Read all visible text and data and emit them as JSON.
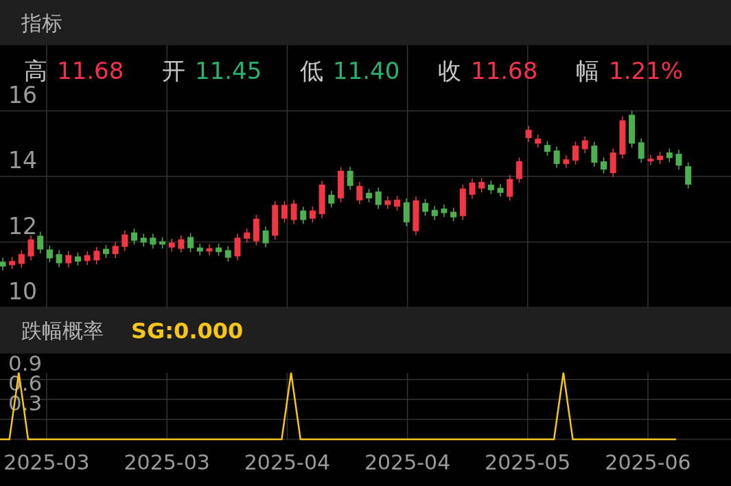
{
  "header": {
    "title": "指标"
  },
  "quote": [
    {
      "label": "高",
      "value": "11.68",
      "color": "#f5314c"
    },
    {
      "label": "开",
      "value": "11.45",
      "color": "#27b36e"
    },
    {
      "label": "低",
      "value": "11.40",
      "color": "#27b36e"
    },
    {
      "label": "收",
      "value": "11.68",
      "color": "#f5314c"
    },
    {
      "label": "幅",
      "value": "1.21%",
      "color": "#f5314c"
    }
  ],
  "price_chart": {
    "chart_data": {
      "type": "candlestick",
      "ylim": [
        10,
        18
      ],
      "yticks": [
        10,
        12,
        14,
        16
      ],
      "grid": true,
      "ohlc": [
        [
          11.4,
          11.52,
          11.13,
          11.25
        ],
        [
          11.29,
          11.54,
          11.17,
          11.42
        ],
        [
          11.33,
          11.75,
          11.21,
          11.63
        ],
        [
          11.56,
          12.2,
          11.44,
          12.08
        ],
        [
          12.19,
          12.31,
          11.65,
          11.77
        ],
        [
          11.77,
          11.89,
          11.38,
          11.5
        ],
        [
          11.63,
          11.75,
          11.23,
          11.35
        ],
        [
          11.35,
          11.72,
          11.23,
          11.6
        ],
        [
          11.56,
          11.68,
          11.28,
          11.4
        ],
        [
          11.42,
          11.72,
          11.3,
          11.6
        ],
        [
          11.44,
          11.85,
          11.32,
          11.73
        ],
        [
          11.79,
          11.91,
          11.51,
          11.63
        ],
        [
          11.63,
          12.0,
          11.51,
          11.88
        ],
        [
          11.85,
          12.35,
          11.73,
          12.23
        ],
        [
          12.29,
          12.41,
          11.92,
          12.04
        ],
        [
          12.13,
          12.25,
          11.86,
          11.98
        ],
        [
          12.13,
          12.25,
          11.8,
          11.92
        ],
        [
          12.02,
          12.14,
          11.8,
          11.92
        ],
        [
          11.83,
          12.1,
          11.71,
          11.98
        ],
        [
          11.79,
          12.2,
          11.67,
          12.08
        ],
        [
          12.15,
          12.27,
          11.69,
          11.81
        ],
        [
          11.83,
          11.95,
          11.59,
          11.71
        ],
        [
          11.71,
          11.93,
          11.59,
          11.81
        ],
        [
          11.83,
          11.95,
          11.57,
          11.69
        ],
        [
          11.75,
          11.87,
          11.4,
          11.52
        ],
        [
          11.56,
          12.25,
          11.44,
          12.13
        ],
        [
          12.1,
          12.41,
          11.98,
          12.29
        ],
        [
          12.02,
          12.83,
          11.9,
          12.71
        ],
        [
          12.35,
          12.47,
          11.84,
          11.96
        ],
        [
          12.19,
          13.25,
          12.07,
          13.13
        ],
        [
          12.71,
          13.25,
          12.59,
          13.13
        ],
        [
          12.67,
          13.29,
          12.55,
          13.17
        ],
        [
          12.96,
          13.08,
          12.55,
          12.67
        ],
        [
          12.71,
          13.08,
          12.59,
          12.96
        ],
        [
          12.85,
          13.87,
          12.73,
          13.75
        ],
        [
          13.44,
          13.56,
          13.05,
          13.17
        ],
        [
          13.33,
          14.29,
          13.21,
          14.17
        ],
        [
          14.17,
          14.29,
          13.59,
          13.71
        ],
        [
          13.27,
          13.83,
          13.15,
          13.71
        ],
        [
          13.5,
          13.62,
          13.21,
          13.33
        ],
        [
          13.54,
          13.66,
          13.01,
          13.13
        ],
        [
          13.13,
          13.39,
          13.01,
          13.27
        ],
        [
          13.08,
          13.41,
          12.96,
          13.29
        ],
        [
          13.21,
          13.33,
          12.48,
          12.6
        ],
        [
          12.33,
          13.39,
          12.21,
          13.27
        ],
        [
          13.19,
          13.31,
          12.8,
          12.92
        ],
        [
          12.98,
          13.1,
          12.67,
          12.79
        ],
        [
          13.02,
          13.14,
          12.76,
          12.88
        ],
        [
          12.92,
          13.04,
          12.63,
          12.75
        ],
        [
          12.79,
          13.75,
          12.67,
          13.63
        ],
        [
          13.44,
          13.93,
          13.32,
          13.81
        ],
        [
          13.63,
          13.95,
          13.51,
          13.83
        ],
        [
          13.75,
          13.87,
          13.46,
          13.58
        ],
        [
          13.65,
          13.77,
          13.38,
          13.5
        ],
        [
          13.38,
          14.04,
          13.26,
          13.92
        ],
        [
          13.92,
          14.58,
          13.8,
          14.46
        ],
        [
          15.17,
          15.54,
          15.05,
          15.42
        ],
        [
          15.0,
          15.27,
          14.88,
          15.15
        ],
        [
          14.96,
          15.08,
          14.63,
          14.75
        ],
        [
          14.79,
          14.91,
          14.26,
          14.38
        ],
        [
          14.38,
          14.64,
          14.26,
          14.52
        ],
        [
          14.48,
          15.06,
          14.36,
          14.94
        ],
        [
          14.83,
          15.22,
          14.71,
          15.1
        ],
        [
          14.94,
          15.06,
          14.3,
          14.42
        ],
        [
          14.46,
          14.58,
          14.09,
          14.21
        ],
        [
          14.1,
          14.85,
          13.98,
          14.73
        ],
        [
          14.67,
          15.83,
          14.55,
          15.71
        ],
        [
          15.88,
          16.0,
          14.88,
          15.0
        ],
        [
          15.04,
          15.16,
          14.42,
          14.54
        ],
        [
          14.46,
          14.66,
          14.34,
          14.54
        ],
        [
          14.5,
          14.75,
          14.38,
          14.63
        ],
        [
          14.73,
          14.85,
          14.44,
          14.56
        ],
        [
          14.69,
          14.81,
          14.21,
          14.33
        ],
        [
          14.31,
          14.43,
          13.63,
          13.75
        ]
      ]
    }
  },
  "indicator": {
    "title": "跌幅概率",
    "reading": "SG:0.000",
    "chart_data": {
      "type": "line",
      "ylim": [
        0,
        1
      ],
      "yticks": [
        0.3,
        0.6,
        0.9
      ],
      "grid": true,
      "series": [
        {
          "color": "#f5c518",
          "values": [
            0,
            0,
            1,
            0,
            0,
            0,
            0,
            0,
            0,
            0,
            0,
            0,
            0,
            0,
            0,
            0,
            0,
            0,
            0,
            0,
            0,
            0,
            0,
            0,
            0,
            0,
            0,
            0,
            0,
            0,
            0,
            1,
            0,
            0,
            0,
            0,
            0,
            0,
            0,
            0,
            0,
            0,
            0,
            0,
            0,
            0,
            0,
            0,
            0,
            0,
            0,
            0,
            0,
            0,
            0,
            0,
            0,
            0,
            0,
            0,
            1,
            0,
            0,
            0,
            0,
            0,
            0,
            0,
            0,
            0,
            0,
            0,
            0
          ]
        }
      ]
    }
  },
  "date_axis": [
    "2025-03",
    "2025-03",
    "2025-04",
    "2025-04",
    "2025-05",
    "2025-06"
  ]
}
